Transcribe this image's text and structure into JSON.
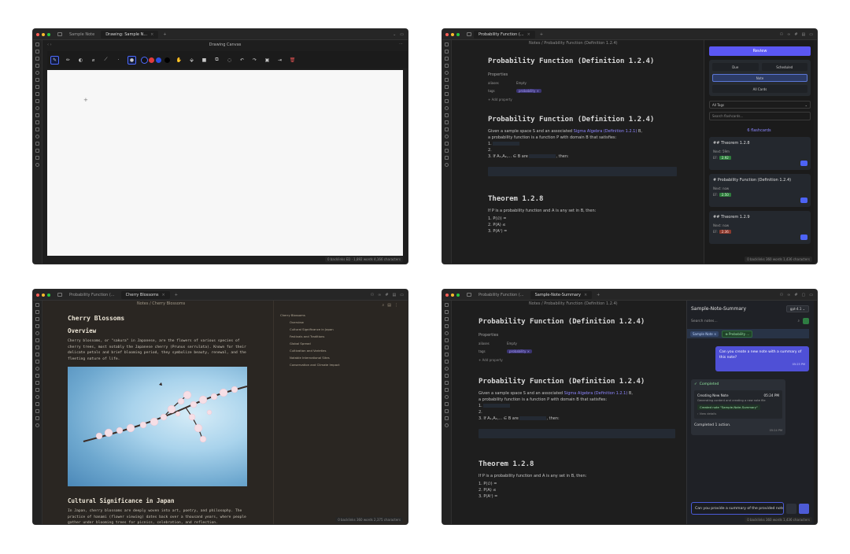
{
  "colors": {
    "accent": "#5b57f2",
    "tag": "#a89bff",
    "pen_red": "#e03b3b",
    "pen_blue": "#2c4ee0"
  },
  "window1": {
    "tabs": [
      "Sample Note",
      "Drawing: Sample N..."
    ],
    "subtitle": "Drawing Canvas",
    "status": "0 backlinks   ED · 1,892 words 4,166 characters"
  },
  "window2": {
    "tab": "Probability Function (...",
    "breadcrumb": "Notes / Probability Function (Definition 1.2.4)",
    "title": "Probability Function (Definition 1.2.4)",
    "properties_label": "Properties",
    "prop_aliases_key": "aliases",
    "prop_aliases_val": "Empty",
    "prop_tags_key": "tags",
    "prop_tags_val": "probability ×",
    "add_property": "+ Add property",
    "heading2": "Probability Function (Definition 1.2.4)",
    "para1_a": "Given a sample space S and an associated ",
    "para1_link": "Sigma Algebra (Definition 1.2.1)",
    "para1_b": " B,",
    "para1_c": "a probability function is a function P with domain B that satisfies:",
    "list": [
      "1.",
      "2.",
      "3. If A₁,A₂,… ∈ B are",
      ", then:"
    ],
    "theorem_title": "Theorem 1.2.8",
    "theorem_text": "If P is a probability function and A is any set in B, then:",
    "theorem_list": [
      "1. P(∅) =",
      "2. P(A) ≤",
      "3. P(Aᶜ) ="
    ],
    "review": "Review",
    "filters": [
      "Due",
      "Scheduled",
      "Note",
      "All Cards"
    ],
    "tags_select": "All Tags",
    "search_placeholder": "Search flashcards...",
    "count": "6 flashcards",
    "cards": [
      {
        "title": "## Theorem 1.2.8",
        "next": "Next: 59m",
        "ef": "2.92"
      },
      {
        "title": "# Probability Function (Definition 1.2.4)",
        "next": "Next: now",
        "ef": "2.50"
      },
      {
        "title": "## Theorem 1.2.9",
        "next": "Next: now",
        "ef": "2.36"
      }
    ],
    "ef_label": "EF:",
    "status": "0 backlinks   360 words 1,436 characters"
  },
  "window3": {
    "tabs": [
      "Probability Function (...",
      "Cherry Blossoms"
    ],
    "breadcrumb": "Notes / Cherry Blossoms",
    "title": "Cherry Blossoms",
    "overview": "Overview",
    "para": "Cherry blossoms, or \"sakura\" in Japanese, are the flowers of various species of cherry trees, most notably the Japanese cherry (Prunus serrulata). Known for their delicate petals and brief blooming period, they symbolize beauty, renewal, and the fleeting nature of life.",
    "section2": "Cultural Significance in Japan",
    "para2": "In Japan, cherry blossoms are deeply woven into art, poetry, and philosophy. The practice of hanami (flower viewing) dates back over a thousand years, where people gather under blooming trees for picnics, celebration, and reflection.",
    "outline": [
      "Cherry Blossoms",
      "Overview",
      "Cultural Significance in Japan",
      "Festivals and Traditions",
      "Global Spread",
      "Cultivation and Varieties",
      "Notable International Sites",
      "Conservation and Climate Impact"
    ],
    "status": "0 backlinks   360 words 2,375 characters"
  },
  "window4": {
    "tabs": [
      "Probability Function (...",
      "Sample-Note-Summary"
    ],
    "breadcrumb": "Notes / Probability Function (Definition 1.2.4)",
    "chat_title": "Sample-Note-Summary",
    "model": "gpt-4.1",
    "search_placeholder": "Search notes...",
    "ctx_note": "Sample Note ×",
    "ctx_prob": "⊕ Probability ...",
    "user_msg": "Can you create a new note with a summary of this note?",
    "user_time": "05:25 PM",
    "completed": "Completed",
    "action_title": "Creating New Note",
    "action_time": "05:24 PM",
    "action_sub": "Generating content and creating a new note file",
    "action_note": "Created note \"Sample-Note-Summary\"",
    "view_details": "› View details",
    "ai_msg": "Completed 1 action.",
    "ai_time": "05:24 PM",
    "input_value": "Can you provide a summary of the provided note",
    "status": "0 backlinks   360 words 1,436 characters"
  }
}
